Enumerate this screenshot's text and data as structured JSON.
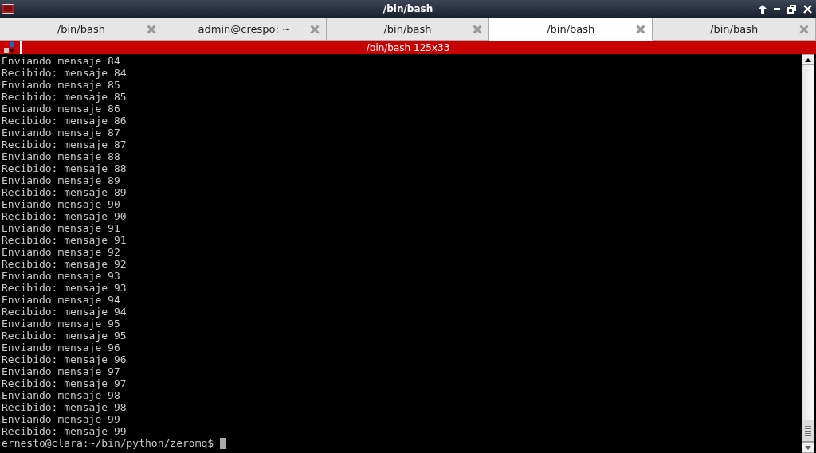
{
  "window": {
    "title": "/bin/bash"
  },
  "tabs": [
    {
      "label": "/bin/bash",
      "selected": false
    },
    {
      "label": "admin@crespo: ~",
      "selected": false
    },
    {
      "label": "/bin/bash",
      "selected": false
    },
    {
      "label": "/bin/bash",
      "selected": true
    },
    {
      "label": "/bin/bash",
      "selected": false
    }
  ],
  "terminal": {
    "title": "/bin/bash 125x33",
    "lines": [
      "Enviando mensaje 84",
      "Recibido: mensaje 84",
      "Enviando mensaje 85",
      "Recibido: mensaje 85",
      "Enviando mensaje 86",
      "Recibido: mensaje 86",
      "Enviando mensaje 87",
      "Recibido: mensaje 87",
      "Enviando mensaje 88",
      "Recibido: mensaje 88",
      "Enviando mensaje 89",
      "Recibido: mensaje 89",
      "Enviando mensaje 90",
      "Recibido: mensaje 90",
      "Enviando mensaje 91",
      "Recibido: mensaje 91",
      "Enviando mensaje 92",
      "Recibido: mensaje 92",
      "Enviando mensaje 93",
      "Recibido: mensaje 93",
      "Enviando mensaje 94",
      "Recibido: mensaje 94",
      "Enviando mensaje 95",
      "Recibido: mensaje 95",
      "Enviando mensaje 96",
      "Recibido: mensaje 96",
      "Enviando mensaje 97",
      "Recibido: mensaje 97",
      "Enviando mensaje 98",
      "Recibido: mensaje 98",
      "Enviando mensaje 99",
      "Recibido: mensaje 99"
    ],
    "prompt": "ernesto@clara:~/bin/python/zeromq$"
  }
}
